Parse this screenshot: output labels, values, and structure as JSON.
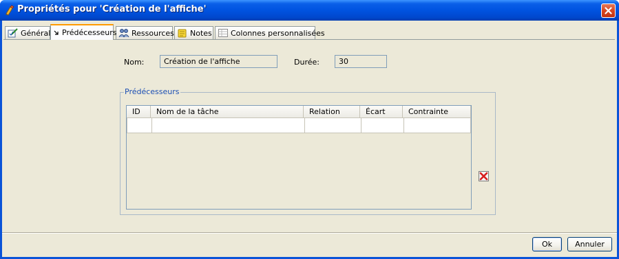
{
  "window": {
    "title": "Propriétés pour 'Création de l'affiche'"
  },
  "tabs": [
    {
      "label": "Général",
      "icon": "general-icon"
    },
    {
      "label": "Prédécesseurs",
      "icon": "arrow-down-right-icon"
    },
    {
      "label": "Ressources",
      "icon": "resources-icon"
    },
    {
      "label": "Notes",
      "icon": "notes-icon"
    },
    {
      "label": "Colonnes personnalisées",
      "icon": "table-icon"
    }
  ],
  "active_tab": "Prédécesseurs",
  "form": {
    "name_label": "Nom:",
    "name_value": "Création de l'affiche",
    "duration_label": "Durée:",
    "duration_value": "30"
  },
  "predecessors": {
    "group_title": "Prédécesseurs",
    "columns": [
      "ID",
      "Nom de la tâche",
      "Relation",
      "Écart",
      "Contrainte"
    ],
    "rows": [
      [
        "",
        "",
        "",
        "",
        ""
      ]
    ]
  },
  "buttons": {
    "ok": "Ok",
    "cancel": "Annuler"
  },
  "colors": {
    "titlebar": "#0053e0",
    "active_tab_accent": "#ff9a00",
    "group_title": "#1c4fb4"
  }
}
